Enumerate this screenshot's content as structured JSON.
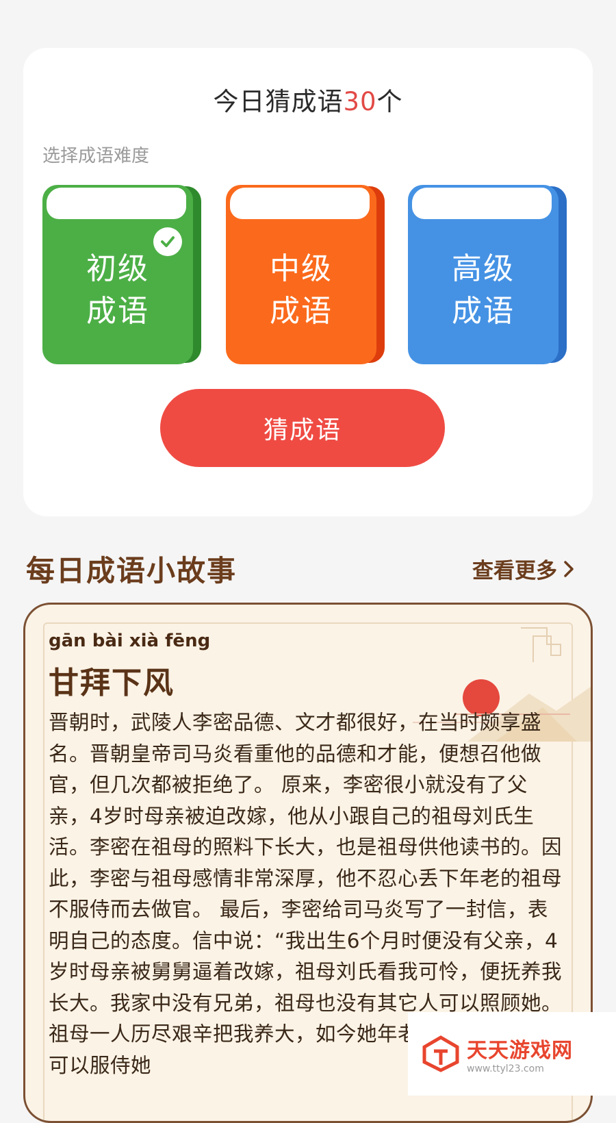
{
  "today": {
    "title_prefix": "今日猜成语",
    "count": "30",
    "title_suffix": "个"
  },
  "difficulty": {
    "label": "选择成语难度",
    "levels": [
      {
        "line1": "初级",
        "line2": "成语",
        "color": "#4caf46",
        "selected": true
      },
      {
        "line1": "中级",
        "line2": "成语",
        "color": "#fb6a1c",
        "selected": false
      },
      {
        "line1": "高级",
        "line2": "成语",
        "color": "#4592e4",
        "selected": false
      }
    ]
  },
  "guess_button": "猜成语",
  "story_section": {
    "title": "每日成语小故事",
    "see_more": "查看更多",
    "pinyin": "gān bài xià fēng",
    "idiom": "甘拜下风",
    "text": "晋朝时，武陵人李密品德、文才都很好，在当时颇享盛名。晋朝皇帝司马炎看重他的品德和才能，便想召他做官，但几次都被拒绝了。 原来，李密很小就没有了父亲，4岁时母亲被迫改嫁，他从小跟自己的祖母刘氏生活。李密在祖母的照料下长大，也是祖母供他读书的。因此，李密与祖母感情非常深厚，他不忍心丢下年老的祖母不服侍而去做官。 最后，李密给司马炎写了一封信，表明自己的态度。信中说：“我出生6个月时便没有父亲，4岁时母亲被舅舅逼着改嫁，祖母刘氏看我可怜，便抚养我长大。我家中没有兄弟，祖母也没有其它人可以照顾她。祖母一人历尽艰辛把我养大，如今她年老了，只有我一人可以服侍她"
  },
  "watermark": {
    "name": "天天游戏网",
    "url": "www.ttyl23.com"
  }
}
